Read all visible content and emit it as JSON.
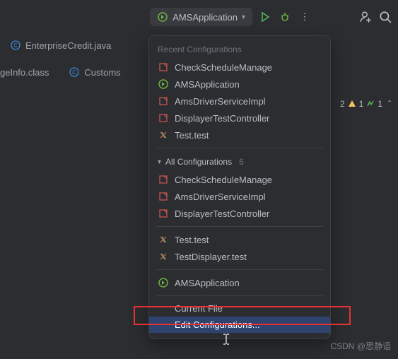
{
  "toolbar": {
    "selected_config": "AMSApplication"
  },
  "tabs": {
    "row1": [
      {
        "label": "EnterpriseCredit.java"
      }
    ],
    "row2": [
      {
        "label": "geInfo.class"
      },
      {
        "label": "Customs"
      }
    ]
  },
  "status": {
    "error_count": "2",
    "warning_count": "1",
    "typo_count": "1"
  },
  "dropdown": {
    "recent_header": "Recent Configurations",
    "recent": [
      {
        "label": "CheckScheduleManage",
        "icon": "spring"
      },
      {
        "label": "AMSApplication",
        "icon": "spring-run"
      },
      {
        "label": "AmsDriverServiceImpl",
        "icon": "spring"
      },
      {
        "label": "DisplayerTestController",
        "icon": "spring"
      },
      {
        "label": "Test.test",
        "icon": "junit"
      }
    ],
    "all_header": "All Configurations",
    "all_count": "6",
    "all": [
      {
        "label": "CheckScheduleManage",
        "icon": "spring"
      },
      {
        "label": "AmsDriverServiceImpl",
        "icon": "spring"
      },
      {
        "label": "DisplayerTestController",
        "icon": "spring"
      }
    ],
    "tests": [
      {
        "label": "Test.test",
        "icon": "junit"
      },
      {
        "label": "TestDisplayer.test",
        "icon": "junit"
      }
    ],
    "app": [
      {
        "label": "AMSApplication",
        "icon": "spring-run"
      }
    ],
    "current_file": "Current File",
    "edit_config": "Edit Configurations..."
  },
  "watermark": "CSDN @思静语"
}
